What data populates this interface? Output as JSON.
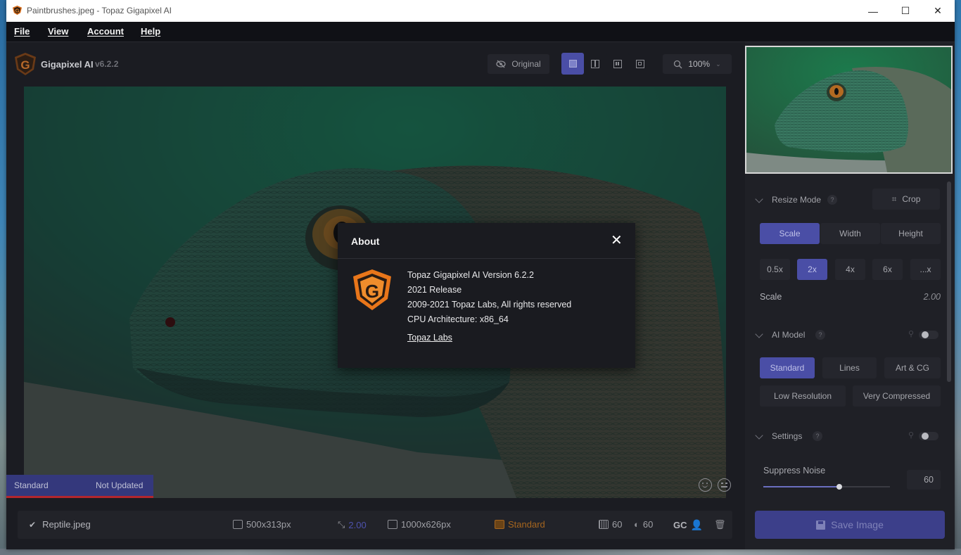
{
  "window": {
    "title": "Paintbrushes.jpeg - Topaz Gigapixel AI",
    "minimize_glyph": "—",
    "maximize_glyph": "☐",
    "close_glyph": "✕"
  },
  "menu": {
    "items": [
      "File",
      "View",
      "Account",
      "Help"
    ]
  },
  "header": {
    "app_name": "Gigapixel AI",
    "version": "v6.2.2",
    "original_label": "Original",
    "zoom": "100%"
  },
  "canvas": {
    "model_tag": "Standard",
    "update_tag": "Not Updated"
  },
  "bottom_bar": {
    "filename": "Reptile.jpeg",
    "input_size": "500x313px",
    "scale": "2.00",
    "output_size": "1000x626px",
    "model": "Standard",
    "noise": "60",
    "blur": "60",
    "gc_label": "GC"
  },
  "sidebar": {
    "resize_mode": {
      "title": "Resize Mode",
      "crop_label": "Crop",
      "modes": [
        "Scale",
        "Width",
        "Height"
      ],
      "factors": [
        "0.5x",
        "2x",
        "4x",
        "6x",
        "...x"
      ],
      "scale_label": "Scale",
      "scale_value": "2.00"
    },
    "ai_model": {
      "title": "AI Model",
      "models_row1": [
        "Standard",
        "Lines",
        "Art & CG"
      ],
      "models_row2": [
        "Low Resolution",
        "Very Compressed"
      ]
    },
    "settings": {
      "title": "Settings",
      "suppress_noise_label": "Suppress Noise",
      "suppress_noise_value": "60",
      "suppress_noise_level": 0.6
    },
    "save_label": "Save Image"
  },
  "about": {
    "title": "About",
    "lines": [
      "Topaz Gigapixel AI Version 6.2.2",
      "2021 Release",
      "2009-2021 Topaz Labs, All rights reserved",
      "CPU Architecture: x86_64"
    ],
    "link": "Topaz Labs"
  },
  "colors": {
    "accent": "#4a4ea6",
    "brand_orange": "#f07a1a",
    "status_red": "#b3262d"
  }
}
